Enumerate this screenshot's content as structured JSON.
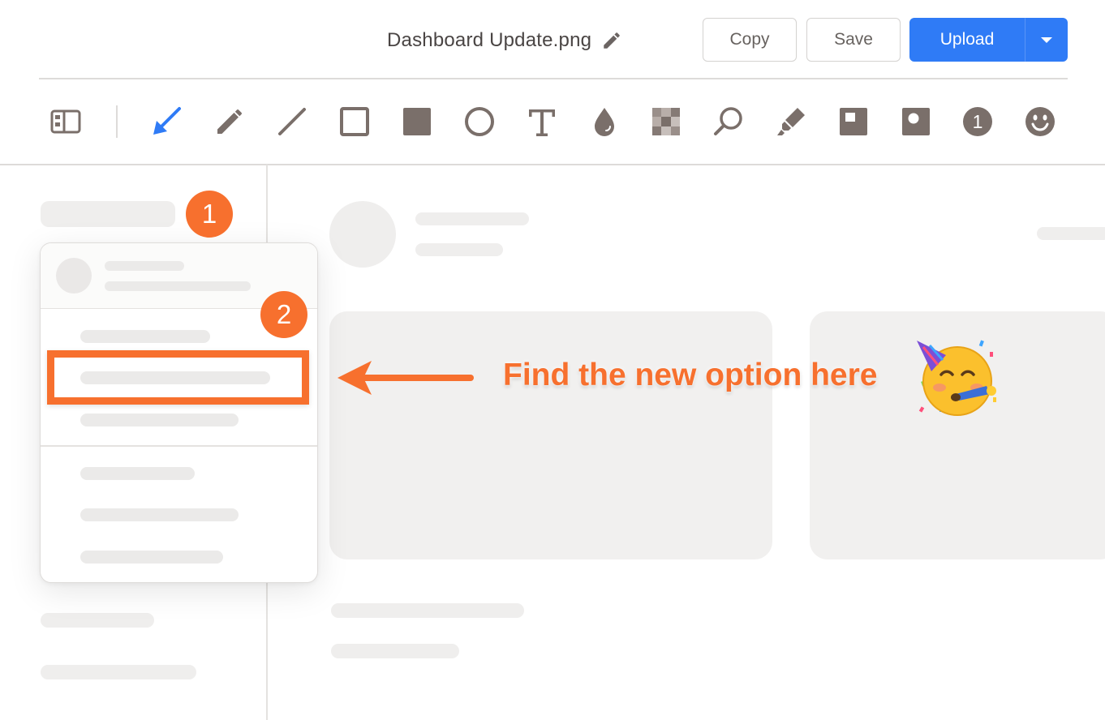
{
  "header": {
    "filename": "Dashboard Update.png",
    "edit_icon": "pencil-icon",
    "copy_label": "Copy",
    "save_label": "Save",
    "upload_label": "Upload",
    "upload_menu_icon": "caret-down-icon"
  },
  "toolbar": {
    "tools": [
      {
        "name": "layout-toggle-icon"
      },
      {
        "name": "arrow-icon",
        "selected": true
      },
      {
        "name": "pencil-icon"
      },
      {
        "name": "line-icon"
      },
      {
        "name": "rectangle-outline-icon"
      },
      {
        "name": "rectangle-filled-icon"
      },
      {
        "name": "ellipse-icon"
      },
      {
        "name": "text-icon"
      },
      {
        "name": "blur-drop-icon"
      },
      {
        "name": "pixelate-icon"
      },
      {
        "name": "magnifier-icon"
      },
      {
        "name": "highlighter-icon"
      },
      {
        "name": "spotlight-square-icon"
      },
      {
        "name": "spotlight-rounded-icon"
      },
      {
        "name": "counter-icon",
        "label": "1"
      },
      {
        "name": "emoji-icon"
      }
    ]
  },
  "annotations": {
    "badge_1": "1",
    "badge_2": "2",
    "callout_text": "Find the new option here",
    "emoji": "partying-face"
  },
  "colors": {
    "accent": "#f7702e",
    "primary_button": "#2f7bf6",
    "tool_icon": "#7a6f6a",
    "selected_tool": "#2f7bf6"
  }
}
